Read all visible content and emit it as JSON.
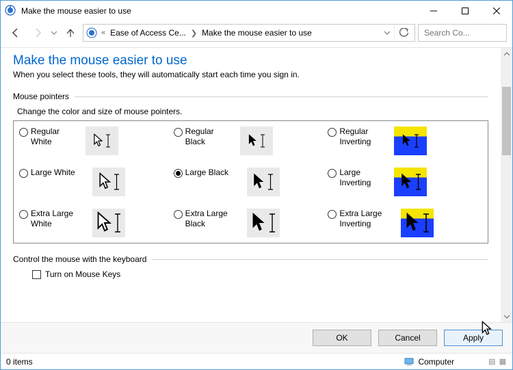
{
  "window": {
    "title": "Make the mouse easier to use",
    "breadcrumb": {
      "prefix": "«",
      "seg1": "Ease of Access Ce...",
      "seg2": "Make the mouse easier to use"
    }
  },
  "search": {
    "placeholder": "Search Co..."
  },
  "heading": "Make the mouse easier to use",
  "subheading": "When you select these tools, they will automatically start each time you sign in.",
  "group1": {
    "title": "Mouse pointers",
    "desc": "Change the color and size of mouse pointers.",
    "options": {
      "r1c1": "Regular White",
      "r1c2": "Regular Black",
      "r1c3": "Regular Inverting",
      "r2c1": "Large White",
      "r2c2": "Large Black",
      "r2c3": "Large Inverting",
      "r3c1": "Extra Large White",
      "r3c2": "Extra Large Black",
      "r3c3": "Extra Large Inverting"
    },
    "selected": "r2c2"
  },
  "group2": {
    "title": "Control the mouse with the keyboard",
    "check1": "Turn on Mouse Keys"
  },
  "buttons": {
    "ok": "OK",
    "cancel": "Cancel",
    "apply": "Apply"
  },
  "status": {
    "items": "0 items",
    "computer": "Computer"
  }
}
